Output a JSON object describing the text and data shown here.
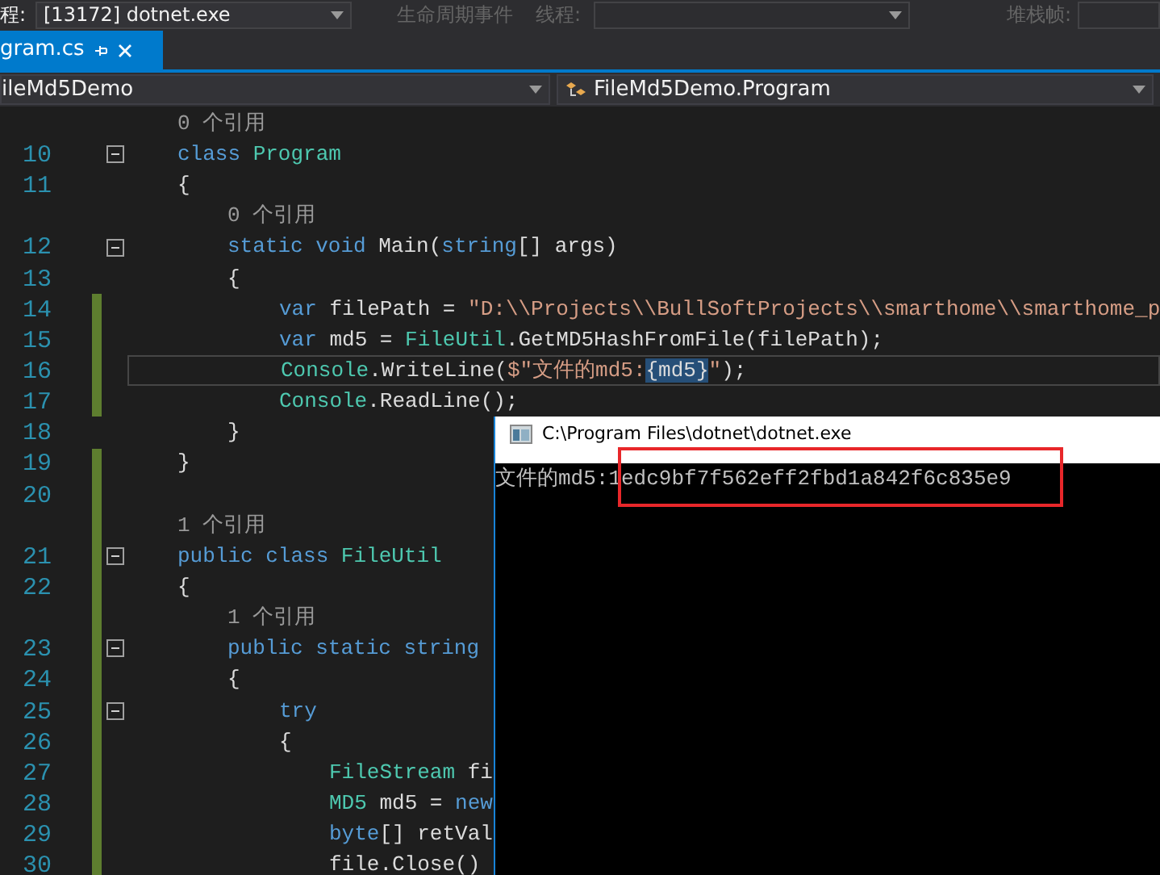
{
  "toolbar": {
    "process_label": "程:",
    "process": "[13172] dotnet.exe",
    "lifecycle": {
      "label": "生命周期事件",
      "disabled": true
    },
    "thread_label": {
      "label": "线程:",
      "disabled": true
    },
    "stack_label": {
      "label": "堆栈帧:",
      "disabled": true
    }
  },
  "tabs": [
    {
      "label": "gram.cs",
      "selected": true
    }
  ],
  "navbar": {
    "project": "ileMd5Demo",
    "type": "FileMd5Demo.Program"
  },
  "lines": [
    {
      "kind": "codelens",
      "changed": false,
      "tokens": [
        {
          "text": "0 个引用",
          "kind": "codelens"
        }
      ]
    },
    {
      "kind": "code",
      "number": "10",
      "changed": false,
      "fold": true,
      "tokens": [
        {
          "text": "class ",
          "kind": "keyword"
        },
        {
          "text": "Program",
          "kind": "type"
        }
      ]
    },
    {
      "kind": "code",
      "number": "11",
      "changed": false,
      "fold": false,
      "tokens": [
        {
          "text": "{",
          "kind": "plain"
        }
      ],
      "children": [
        {
          "kind": "codelens",
          "changed": false,
          "tokens": [
            {
              "text": "0 个引用",
              "kind": "codelens"
            }
          ]
        },
        {
          "kind": "code",
          "number": "12",
          "changed": false,
          "fold": true,
          "tokens": [
            {
              "text": "static void ",
              "kind": "keyword"
            },
            {
              "text": "Main(",
              "kind": "plain"
            },
            {
              "text": "string",
              "kind": "keyword"
            },
            {
              "text": "[] args)",
              "kind": "plain"
            }
          ]
        },
        {
          "kind": "code",
          "number": "13",
          "changed": false,
          "fold": false,
          "tokens": [
            {
              "text": "{",
              "kind": "plain"
            }
          ],
          "children": [
            {
              "kind": "code",
              "number": "14",
              "changed": true,
              "fold": false,
              "tokens": [
                {
                  "text": "var ",
                  "kind": "keyword"
                },
                {
                  "text": "filePath = ",
                  "kind": "plain"
                },
                {
                  "text": "\"D:\\\\Projects\\\\BullSoftProjects\\\\smarthome\\\\smarthome_p",
                  "kind": "string"
                }
              ]
            },
            {
              "kind": "code",
              "number": "15",
              "changed": true,
              "fold": false,
              "tokens": [
                {
                  "text": "var ",
                  "kind": "keyword"
                },
                {
                  "text": "md5 = ",
                  "kind": "plain"
                },
                {
                  "text": "FileUtil",
                  "kind": "type"
                },
                {
                  "text": ".GetMD5HashFromFile(filePath);",
                  "kind": "plain"
                }
              ]
            },
            {
              "kind": "code",
              "number": "16",
              "changed": true,
              "fold": false,
              "current": true,
              "tokens": [
                {
                  "text": "Console",
                  "kind": "type"
                },
                {
                  "text": ".WriteLine(",
                  "kind": "plain"
                },
                {
                  "text": "$\"文件的md5:",
                  "kind": "string"
                },
                {
                  "text": "{md5}",
                  "kind": "interp"
                },
                {
                  "text": "\"",
                  "kind": "string"
                },
                {
                  "text": ");",
                  "kind": "plain"
                }
              ]
            },
            {
              "kind": "code",
              "number": "17",
              "changed": true,
              "fold": false,
              "tokens": [
                {
                  "text": "Console",
                  "kind": "type"
                },
                {
                  "text": ".ReadLine();",
                  "kind": "plain"
                }
              ]
            }
          ]
        },
        {
          "kind": "code",
          "number": "18",
          "changed": false,
          "fold": false,
          "tokens": [
            {
              "text": "}",
              "kind": "plain"
            }
          ]
        }
      ]
    },
    {
      "kind": "code",
      "number": "19",
      "changed": true,
      "fold": false,
      "tokens": [
        {
          "text": "}",
          "kind": "plain"
        }
      ]
    },
    {
      "kind": "code",
      "number": "20",
      "changed": true,
      "fold": false
    },
    {
      "kind": "codelens",
      "changed": true,
      "tokens": [
        {
          "text": "1 个引用",
          "kind": "codelens"
        }
      ]
    },
    {
      "kind": "code",
      "number": "21",
      "changed": true,
      "fold": true,
      "tokens": [
        {
          "text": "public class ",
          "kind": "keyword"
        },
        {
          "text": "FileUtil",
          "kind": "type"
        }
      ]
    },
    {
      "kind": "code",
      "number": "22",
      "changed": true,
      "fold": false,
      "tokens": [
        {
          "text": "{",
          "kind": "plain"
        }
      ],
      "children": [
        {
          "kind": "codelens",
          "changed": true,
          "tokens": [
            {
              "text": "1 个引用",
              "kind": "codelens"
            }
          ]
        },
        {
          "kind": "code",
          "number": "23",
          "changed": true,
          "fold": true,
          "tokens": [
            {
              "text": "public static string",
              "kind": "keyword"
            }
          ]
        },
        {
          "kind": "code",
          "number": "24",
          "changed": true,
          "fold": false,
          "tokens": [
            {
              "text": "{",
              "kind": "plain"
            }
          ],
          "children": [
            {
              "kind": "code",
              "number": "25",
              "changed": true,
              "fold": true,
              "tokens": [
                {
                  "text": "try",
                  "kind": "keyword"
                }
              ]
            },
            {
              "kind": "code",
              "number": "26",
              "changed": true,
              "fold": false,
              "tokens": [
                {
                  "text": "{",
                  "kind": "plain"
                }
              ],
              "children": [
                {
                  "kind": "code",
                  "number": "27",
                  "changed": true,
                  "fold": false,
                  "tokens": [
                    {
                      "text": "FileStream ",
                      "kind": "type"
                    },
                    {
                      "text": "fi",
                      "kind": "plain"
                    }
                  ]
                },
                {
                  "kind": "code",
                  "number": "28",
                  "changed": true,
                  "fold": false,
                  "tokens": [
                    {
                      "text": "MD5 ",
                      "kind": "type"
                    },
                    {
                      "text": "md5 = ",
                      "kind": "plain"
                    },
                    {
                      "text": "new",
                      "kind": "keyword"
                    }
                  ]
                },
                {
                  "kind": "code",
                  "number": "29",
                  "changed": true,
                  "fold": false,
                  "tokens": [
                    {
                      "text": "byte",
                      "kind": "keyword"
                    },
                    {
                      "text": "[] retVal",
                      "kind": "plain"
                    }
                  ]
                },
                {
                  "kind": "code",
                  "number": "30",
                  "changed": true,
                  "fold": false,
                  "tokens": [
                    {
                      "text": "file.Close()",
                      "kind": "plain"
                    }
                  ]
                }
              ]
            }
          ]
        }
      ]
    }
  ],
  "console": {
    "title": "C:\\Program Files\\dotnet\\dotnet.exe",
    "output": "文件的md5:1edc9bf7f562eff2fbd1a842f6c835e9"
  }
}
